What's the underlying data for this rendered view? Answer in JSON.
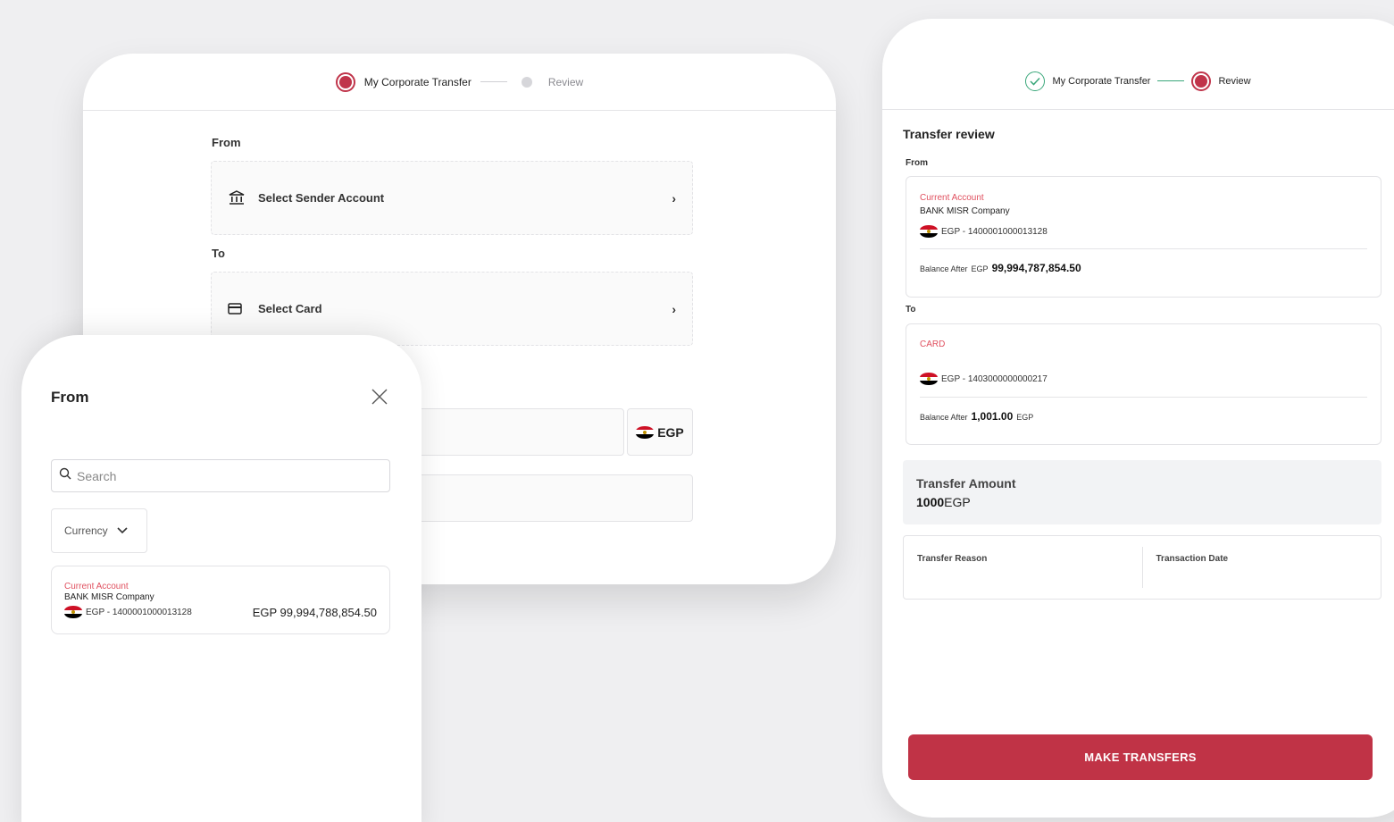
{
  "form": {
    "steps": [
      {
        "label": "My Corporate Transfer",
        "state": "active"
      },
      {
        "label": "Review",
        "state": "pending"
      }
    ],
    "from_label": "From",
    "sender_placeholder": "Select Sender Account",
    "to_label": "To",
    "card_placeholder": "Select Card",
    "currency": "EGP"
  },
  "sheet": {
    "title": "From",
    "search_placeholder": "Search",
    "currency_filter": "Currency",
    "accounts": [
      {
        "type": "Current Account",
        "name": "BANK MISR Company",
        "number": "EGP - 1400001000013128",
        "balance": "EGP 99,994,788,854.50"
      }
    ]
  },
  "review": {
    "steps": [
      {
        "label": "My Corporate Transfer",
        "state": "done"
      },
      {
        "label": "Review",
        "state": "active"
      }
    ],
    "title": "Transfer review",
    "from_label": "From",
    "from": {
      "type": "Current Account",
      "name": "BANK MISR Company",
      "number": "EGP - 1400001000013128",
      "balance_label": "Balance After",
      "balance_currency": "EGP",
      "balance_value": "99,994,787,854.50"
    },
    "to_label": "To",
    "to": {
      "type": "CARD",
      "number": "EGP - 1403000000000217",
      "balance_label": "Balance After",
      "balance_value": "1,001.00",
      "balance_currency": "EGP"
    },
    "amount_label": "Transfer Amount",
    "amount_value": "1000",
    "amount_currency": "EGP",
    "reason_label": "Transfer Reason",
    "date_label": "Transaction Date",
    "submit_label": "MAKE TRANSFERS"
  },
  "colors": {
    "brand": "#c03346",
    "accent_text": "#e0505f",
    "success": "#3aa77a"
  }
}
